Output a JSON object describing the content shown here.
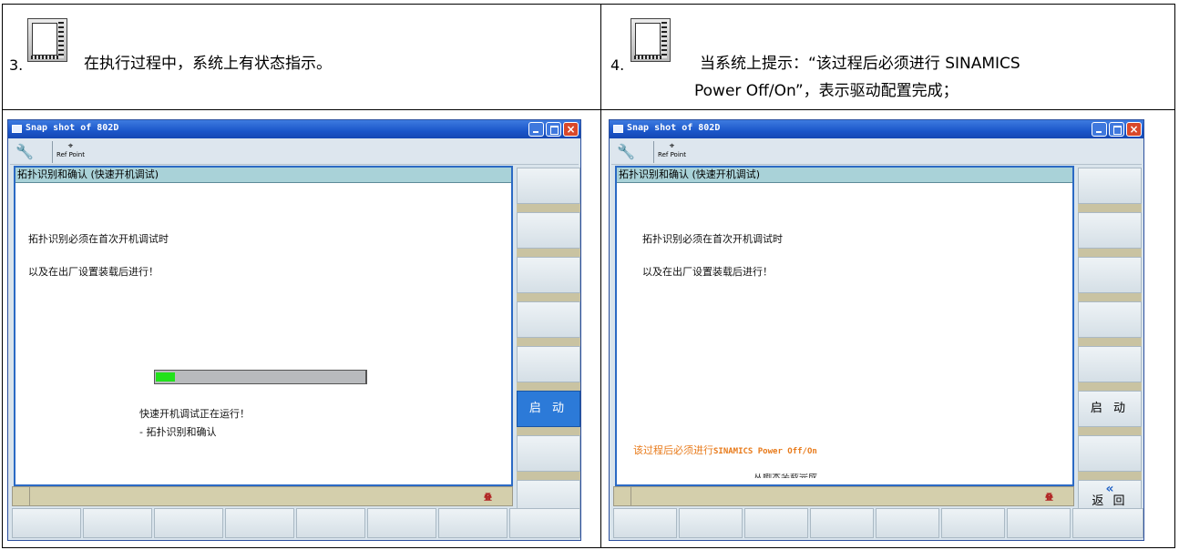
{
  "steps": [
    {
      "number": "3.",
      "text": "在执行过程中，系统上有状态指示。",
      "icon": "monitor-icon"
    },
    {
      "number": "4.",
      "text_line1": "当系统上提示：“该过程后必须进行 SINAMICS",
      "text_line2": "Power Off/On”，表示驱动配置完成；",
      "icon": "monitor-icon"
    }
  ],
  "screens": [
    {
      "window_title": "Snap shot of 802D",
      "toolbar": {
        "wrench_icon": "wrench-icon",
        "ref_point_label": "Ref Point"
      },
      "panel_title": "拓扑识别和确认 (快速开机调试)",
      "message_line1": "拓扑识别必须在首次开机调试时",
      "message_line2": "以及在出厂设置装载后进行！",
      "progress_fraction": 0.09,
      "status_line1": "快速开机调试正在运行！",
      "status_line2": "- 拓扑识别和确认",
      "softkey_start": "启 动",
      "status_mark": "叠"
    },
    {
      "window_title": "Snap shot of 802D",
      "toolbar": {
        "wrench_icon": "wrench-icon",
        "ref_point_label": "Ref Point"
      },
      "panel_title": "拓扑识别和确认 (快速开机调试)",
      "message_line1": "拓扑识别必须在首次开机调试时",
      "message_line2": "以及在出厂设置装载后进行！",
      "warning_prefix": "该过程后必须进行",
      "warning_mono": "SINAMICS Power Off/On",
      "cut_text": "从脚本装载完成",
      "softkey_start": "启 动",
      "softkey_back": "返 回",
      "back_icon": "double-chevron-left-icon",
      "status_mark": "叠"
    }
  ],
  "colors": {
    "titlebar": "#1b56c9",
    "panel_header": "#a9d2d8",
    "progress_fill": "#21e21b",
    "active_softkey": "#2c7ad8",
    "warning_text": "#e87a1a"
  }
}
